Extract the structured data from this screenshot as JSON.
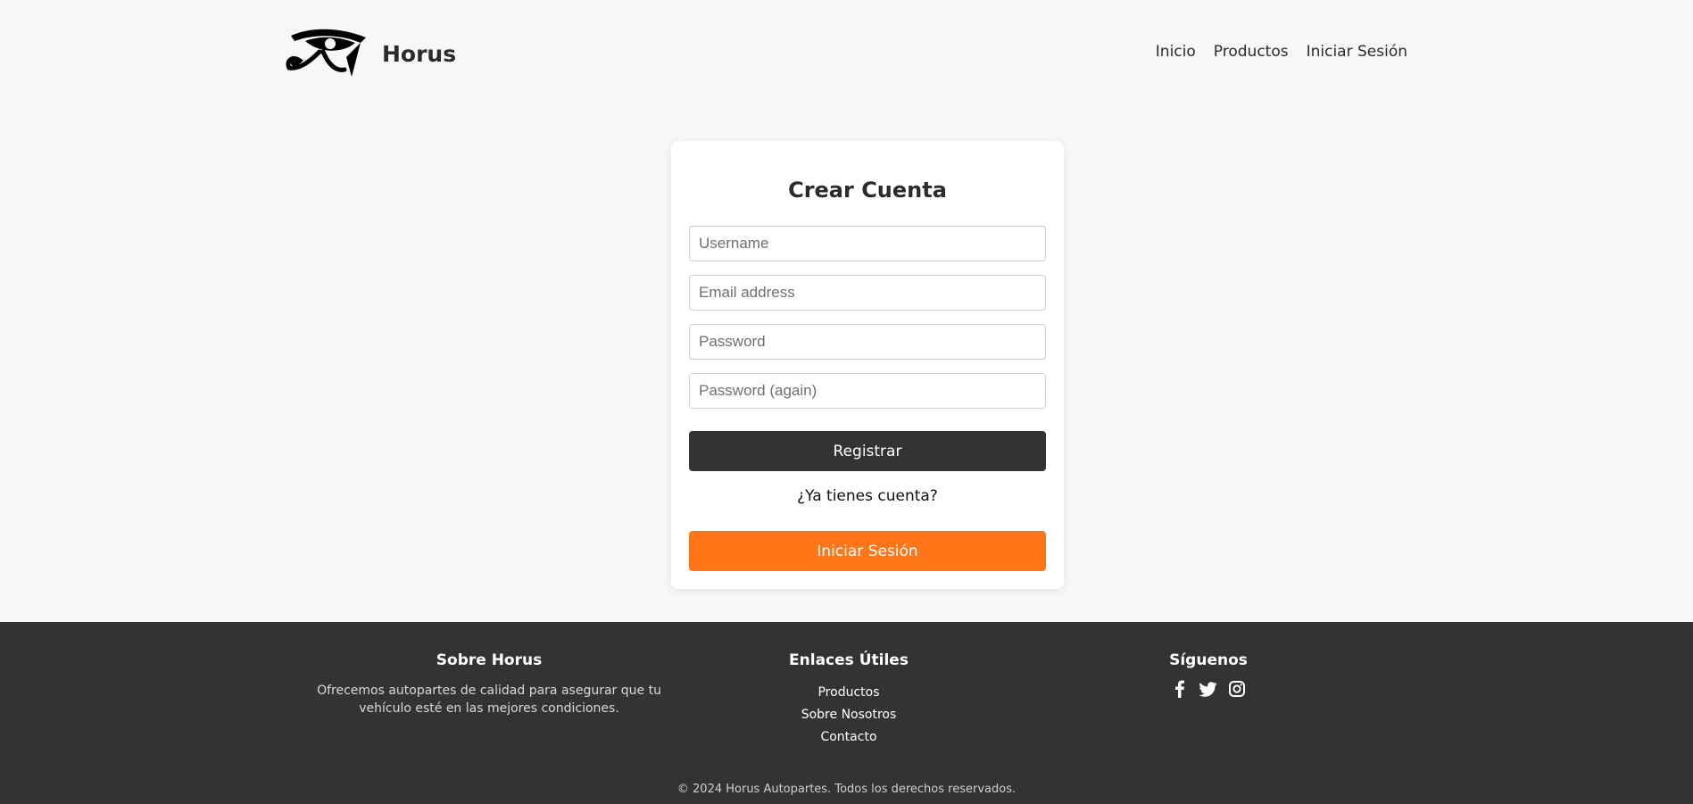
{
  "header": {
    "brand_name": "Horus",
    "nav": [
      {
        "label": "Inicio"
      },
      {
        "label": "Productos"
      },
      {
        "label": "Iniciar Sesión"
      }
    ]
  },
  "form": {
    "title": "Crear Cuenta",
    "fields": {
      "username_placeholder": "Username",
      "email_placeholder": "Email address",
      "password_placeholder": "Password",
      "password_again_placeholder": "Password (again)"
    },
    "register_label": "Registrar",
    "question": "¿Ya tienes cuenta?",
    "login_label": "Iniciar Sesión"
  },
  "footer": {
    "about_title": "Sobre Horus",
    "about_text": "Ofrecemos autopartes de calidad para asegurar que tu vehículo esté en las mejores condiciones.",
    "links_title": "Enlaces Útiles",
    "links": [
      {
        "label": "Productos"
      },
      {
        "label": "Sobre Nosotros"
      },
      {
        "label": "Contacto"
      }
    ],
    "social_title": "Síguenos",
    "social_icons": [
      "facebook-icon",
      "twitter-icon",
      "instagram-icon"
    ],
    "copyright": "© 2024 Horus Autopartes. Todos los derechos reservados."
  },
  "colors": {
    "background": "#f7f7f7",
    "dark": "#333333",
    "accent": "#ff7518",
    "card": "#ffffff"
  }
}
